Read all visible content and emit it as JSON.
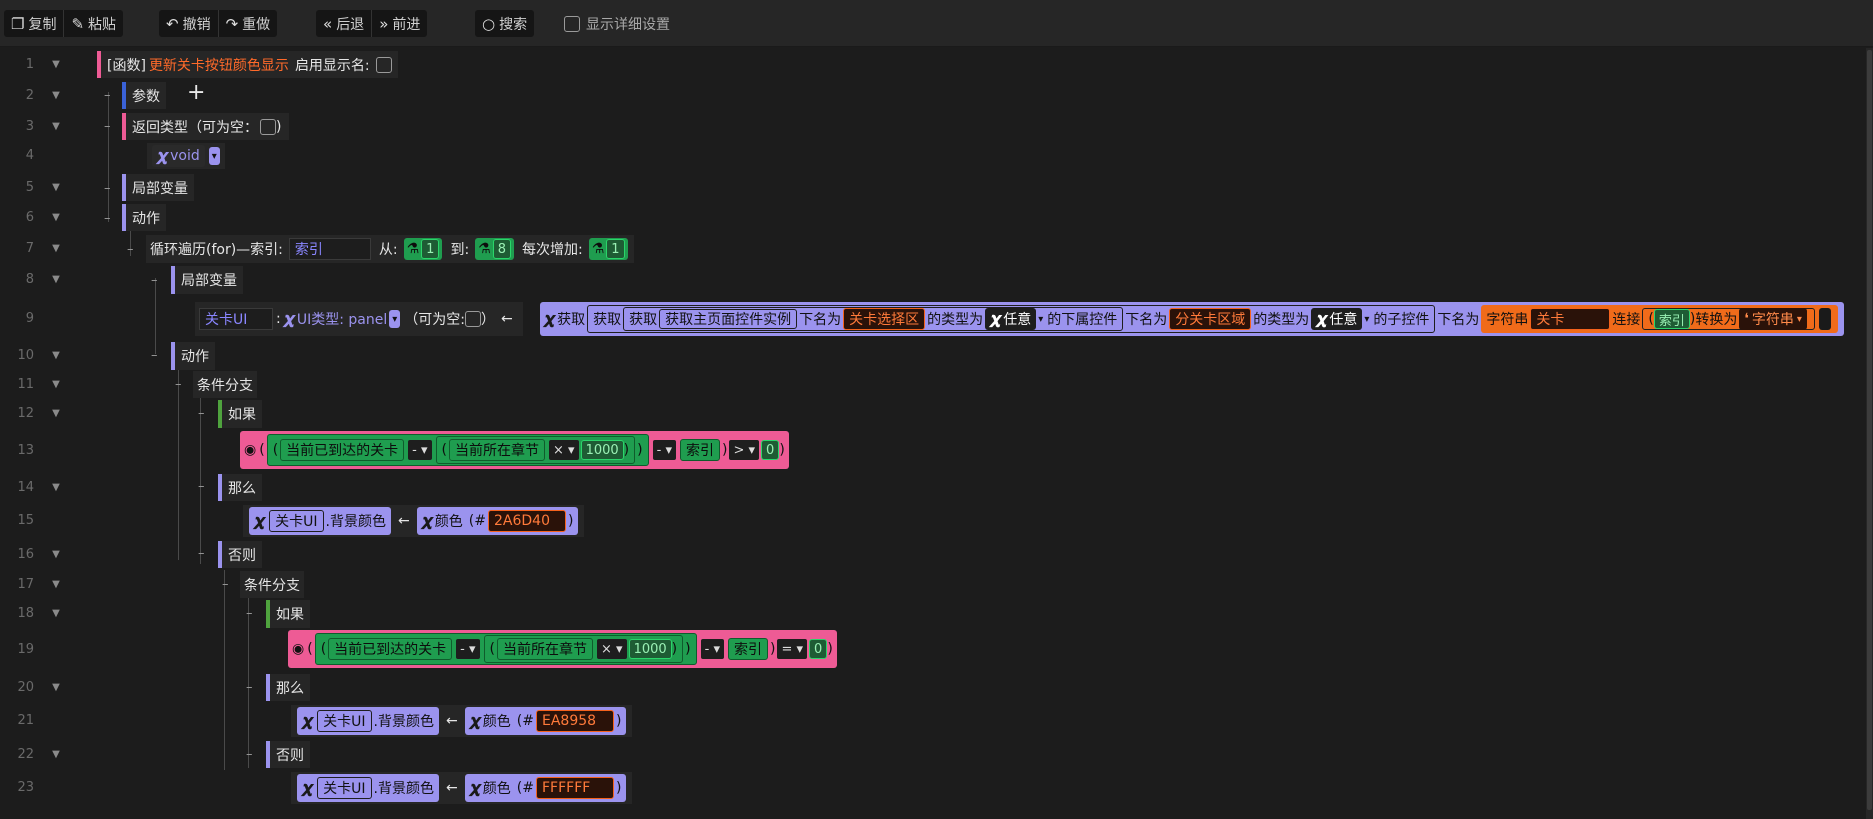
{
  "toolbar": {
    "copy": "复制",
    "paste": "粘贴",
    "undo": "撤销",
    "redo": "重做",
    "back": "后退",
    "forward": "前进",
    "search": "搜索",
    "show_details": "显示详细设置"
  },
  "lines": [
    "1",
    "2",
    "3",
    "4",
    "5",
    "6",
    "7",
    "8",
    "9",
    "10",
    "11",
    "12",
    "13",
    "14",
    "15",
    "16",
    "17",
    "18",
    "19",
    "20",
    "21",
    "22",
    "23"
  ],
  "code": {
    "func_prefix": "[函数]",
    "func_name": "更新关卡按钮颜色显示",
    "enable_display": "启用显示名:",
    "params": "参数",
    "plus": "+",
    "return_type": "返回类型（可为空：",
    "close_paren": ")",
    "void": "void",
    "local_vars": "局部变量",
    "actions": "动作",
    "loop_label": "循环遍历(for)—索引:",
    "loop_index": "索引",
    "from": "从:",
    "from_val": "1",
    "to": "到:",
    "to_val": "8",
    "step": "每次增加:",
    "step_val": "1",
    "local_vars2": "局部变量",
    "var_name": "关卡UI",
    "colon": ":",
    "ui_type": "UI类型: panel",
    "nullable": "（可为空:",
    "rparen": "）",
    "arrow": "←",
    "get": "获取",
    "get_main": "获取主页面控件实例",
    "named": "下名为",
    "level_area": "关卡选择区",
    "type_is": "的类型为",
    "any": "任意",
    "sub_ctrl": "的下属控件",
    "named2": "下名为",
    "sub_level_area": "分关卡区域",
    "type_is2": "的类型为",
    "any2": "任意",
    "child_ctrl": "的子控件",
    "named3": "下名为",
    "string": "字符串",
    "level": "关卡",
    "concat": "连接",
    "index": "索引",
    "convert": "转换为",
    "string2": "字符串",
    "actions2": "动作",
    "cond_branch": "条件分支",
    "if": "如果",
    "cur_level": "当前已到达的关卡",
    "minus": "-",
    "cur_chapter": "当前所在章节",
    "times": "×",
    "thousand": "1000",
    "gt": ">",
    "zero": "0",
    "then": "那么",
    "bg_color": ".背景颜色",
    "color": "颜色",
    "hash": "(#",
    "color1": "2A6D40",
    "else": "否则",
    "cond_branch2": "条件分支",
    "if2": "如果",
    "eq": "=",
    "then2": "那么",
    "color2": "EA8958",
    "else2": "否则",
    "color3": "FFFFFF"
  },
  "colors": {
    "bg": "#1c1c1c",
    "purple": "#9b93ee",
    "green": "#1f9d4f",
    "orange": "#f06b1a",
    "pink": "#ee5b95",
    "bar_blue": "#3a62d8",
    "bar_green": "#4fa33e"
  }
}
